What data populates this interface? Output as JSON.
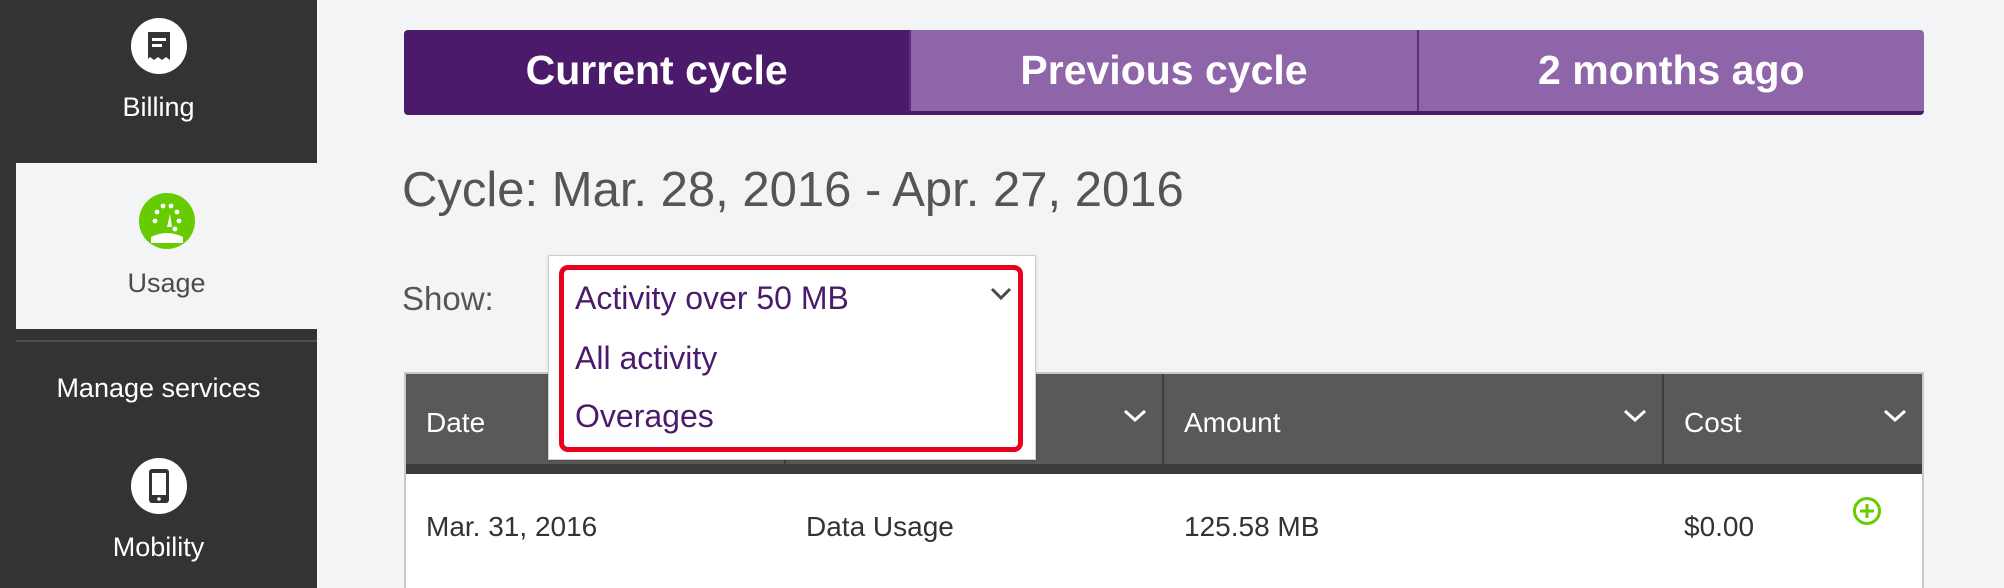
{
  "sidebar": {
    "billing_label": "Billing",
    "usage_label": "Usage",
    "manage_label": "Manage services",
    "mobility_label": "Mobility"
  },
  "tabs": [
    {
      "label": "Current cycle",
      "active": true
    },
    {
      "label": "Previous cycle",
      "active": false
    },
    {
      "label": "2 months ago",
      "active": false
    }
  ],
  "cycle_title": "Cycle: Mar. 28, 2016 - Apr. 27, 2016",
  "filter": {
    "label": "Show:",
    "selected": "Activity over 50 MB",
    "options": [
      "All activity",
      "Overages"
    ]
  },
  "table": {
    "columns": [
      "Date",
      "",
      "Amount",
      "Cost"
    ],
    "rows": [
      {
        "date": "Mar. 31, 2016",
        "type": "Data Usage",
        "amount": "125.58 MB",
        "cost": "$0.00"
      }
    ]
  },
  "colors": {
    "brand_purple": "#4b1a6a",
    "tab_inactive": "#8d65a8",
    "accent_green": "#66cc00",
    "highlight_red": "#e8001c"
  },
  "icons": {
    "billing": "bill-icon",
    "usage": "speedometer-icon",
    "mobility": "mobile-phone-icon",
    "expand": "plus-circle-icon"
  }
}
